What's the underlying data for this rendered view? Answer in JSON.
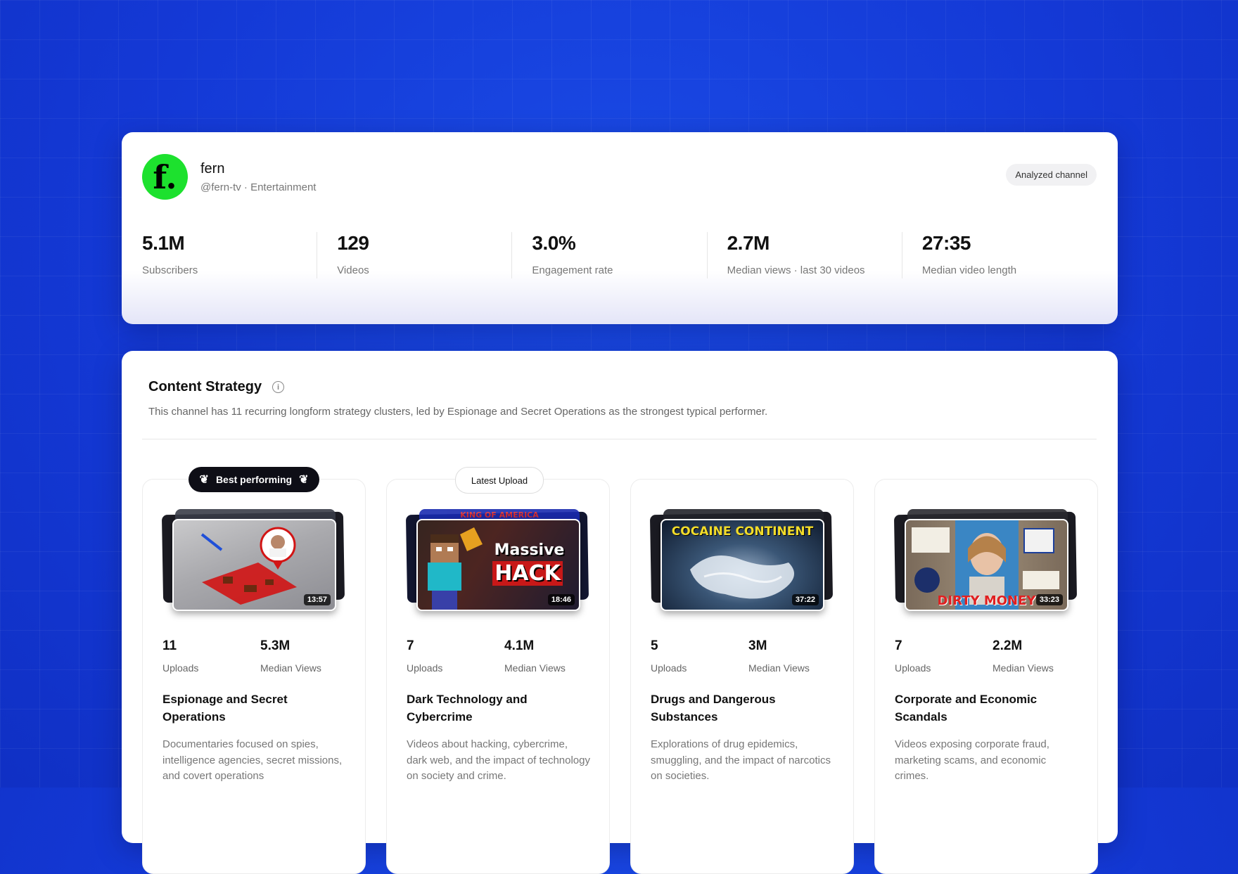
{
  "channel": {
    "avatar_letter": "f.",
    "name": "fern",
    "handle_line": "@fern-tv · Entertainment",
    "badge": "Analyzed channel",
    "stats": [
      {
        "value": "5.1M",
        "label": "Subscribers"
      },
      {
        "value": "129",
        "label": "Videos"
      },
      {
        "value": "3.0%",
        "label": "Engagement rate"
      },
      {
        "value": "2.7M",
        "label": "Median views · last 30 videos"
      },
      {
        "value": "27:35",
        "label": "Median video length"
      }
    ]
  },
  "strategy": {
    "title": "Content Strategy",
    "info_icon": "i",
    "description": "This channel has 11 recurring longform strategy clusters, led by Espionage and Secret Operations as the strongest typical performer.",
    "clusters": [
      {
        "ribbon": "Best performing",
        "laurel_left": "❦",
        "laurel_right": "❦",
        "duration": "13:57",
        "uploads": "11",
        "uploads_label": "Uploads",
        "median_views": "5.3M",
        "median_views_label": "Median Views",
        "title": "Espionage and Secret Operations",
        "description": "Documentaries focused on spies, intelligence agencies, secret missions, and covert operations"
      },
      {
        "ribbon": "Latest Upload",
        "duration": "18:46",
        "back_caption": "KING OF AMERICA",
        "thumb_caption_1": "Massive",
        "thumb_caption_2": "HACK",
        "uploads": "7",
        "uploads_label": "Uploads",
        "median_views": "4.1M",
        "median_views_label": "Median Views",
        "title": "Dark Technology and Cybercrime",
        "description": "Videos about hacking, cybercrime, dark web, and the impact of technology on society and crime."
      },
      {
        "duration": "37:22",
        "thumb_caption": "COCAINE CONTINENT",
        "uploads": "5",
        "uploads_label": "Uploads",
        "median_views": "3M",
        "median_views_label": "Median Views",
        "title": "Drugs and Dangerous Substances",
        "description": "Explorations of drug epidemics, smuggling, and the impact of narcotics on societies."
      },
      {
        "duration": "33:23",
        "thumb_caption": "DIRTY MONEY",
        "uploads": "7",
        "uploads_label": "Uploads",
        "median_views": "2.2M",
        "median_views_label": "Median Views",
        "title": "Corporate and Economic Scandals",
        "description": "Videos exposing corporate fraud, marketing scams, and economic crimes."
      }
    ]
  },
  "colors": {
    "background": "#1439d6",
    "avatar": "#1de12e",
    "ribbon_best": "#0e0e16"
  }
}
